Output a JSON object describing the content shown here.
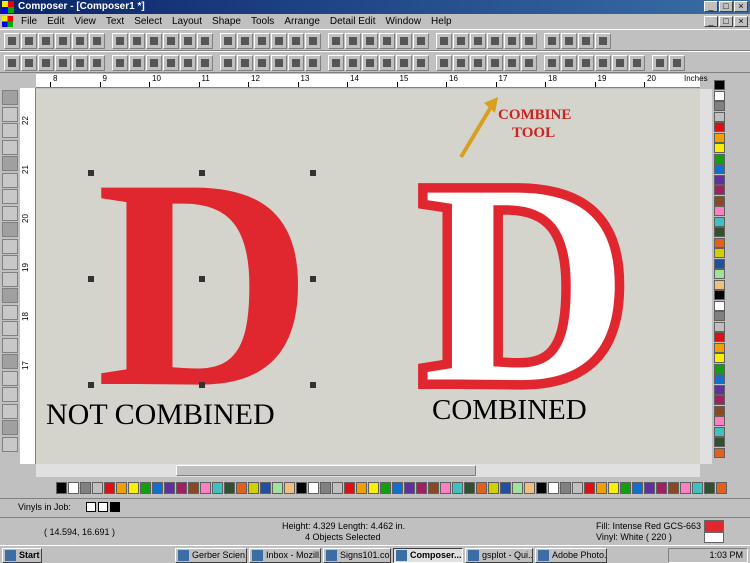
{
  "window": {
    "title": "Composer - [Composer1 *]",
    "controls": [
      "_",
      "□",
      "×"
    ]
  },
  "menu": [
    "File",
    "Edit",
    "View",
    "Text",
    "Select",
    "Layout",
    "Shape",
    "Tools",
    "Arrange",
    "Detail Edit",
    "Window",
    "Help"
  ],
  "ruler": {
    "top_ticks": [
      "8",
      "9",
      "10",
      "11",
      "12",
      "13",
      "14",
      "15",
      "16",
      "17",
      "18",
      "19",
      "20"
    ],
    "left_ticks": [
      "22",
      "21",
      "20",
      "19",
      "18",
      "17"
    ],
    "units": "Inches"
  },
  "canvas": {
    "annotation": "COMBINE\nTOOL",
    "letter_left": "D",
    "letter_right": "D",
    "caption_left": "NOT COMBINED",
    "caption_right": "COMBINED",
    "colors": {
      "red": "#e0262e",
      "white": "#ffffff",
      "bg": "#d4d4cc",
      "annotation": "#cc2222"
    }
  },
  "vinyl": {
    "label": "Vinyls in Job:"
  },
  "status": {
    "coords": "( 14.594, 16.691 )",
    "dims": "Height: 4.329  Length: 4.462  in.",
    "selection": "4 Objects Selected",
    "fill": "Fill: Intense Red GCS-663",
    "vinyl": "Vinyl: White ( 220 )"
  },
  "taskbar": {
    "start": "Start",
    "tasks": [
      {
        "label": "Gerber Scien...",
        "active": false
      },
      {
        "label": "Inbox - Mozill...",
        "active": false
      },
      {
        "label": "Signs101.co...",
        "active": false
      },
      {
        "label": "Composer...",
        "active": true
      },
      {
        "label": "gsplot - Qui...",
        "active": false
      },
      {
        "label": "Adobe Photo...",
        "active": false
      }
    ],
    "time": "1:03 PM"
  },
  "palette": [
    "#000000",
    "#ffffff",
    "#808080",
    "#c0c0c0",
    "#e01010",
    "#f0a000",
    "#f8f000",
    "#10a010",
    "#1070d0",
    "#6030a0",
    "#a02060",
    "#8a4a20",
    "#ff80c0",
    "#40c0c0",
    "#305030",
    "#e06020",
    "#d0d000",
    "#2050a0",
    "#a0e0a0",
    "#f0c080"
  ]
}
